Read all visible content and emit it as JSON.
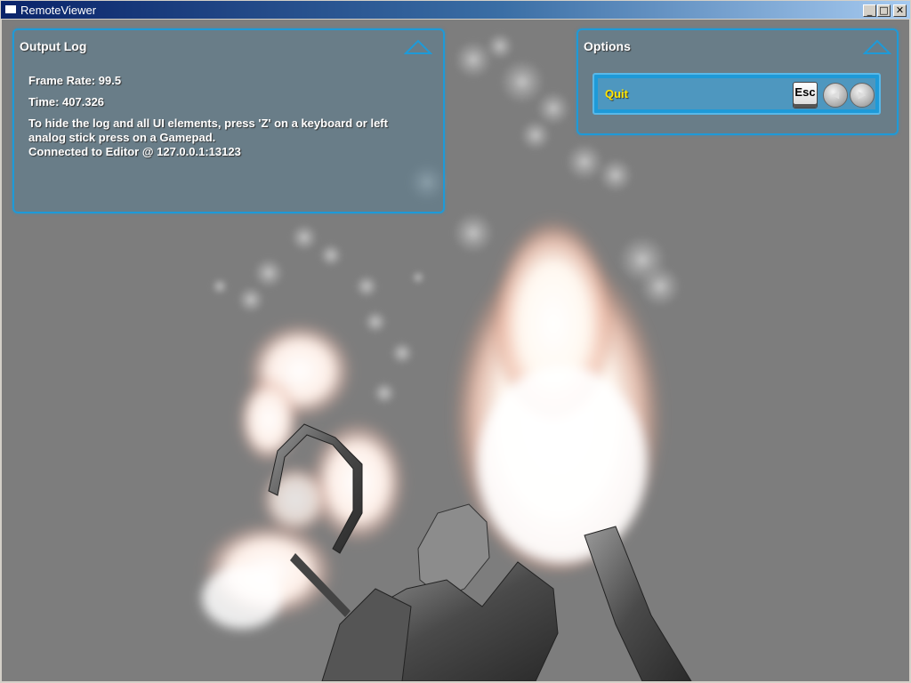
{
  "window": {
    "title": "RemoteViewer",
    "minimize_glyph": "_",
    "maximize_glyph": "□",
    "close_glyph": "✕"
  },
  "output_log": {
    "title": "Output Log",
    "frame_rate": "Frame Rate: 99.5",
    "time": "Time: 407.326",
    "hint_line1": "To hide the log and all UI elements, press 'Z' on a keyboard or left",
    "hint_line2": "analog stick press on a Gamepad.",
    "connection": "Connected to Editor @ 127.0.0.1:13123"
  },
  "options": {
    "title": "Options",
    "quit_label": "Quit",
    "esc_key_label": "Esc",
    "back_button_glyph": "◀",
    "start_button_glyph": "▶"
  },
  "colors": {
    "panel_border": "#1e9ad8",
    "quit_text": "#ffe600",
    "background": "#7d7d7d"
  }
}
